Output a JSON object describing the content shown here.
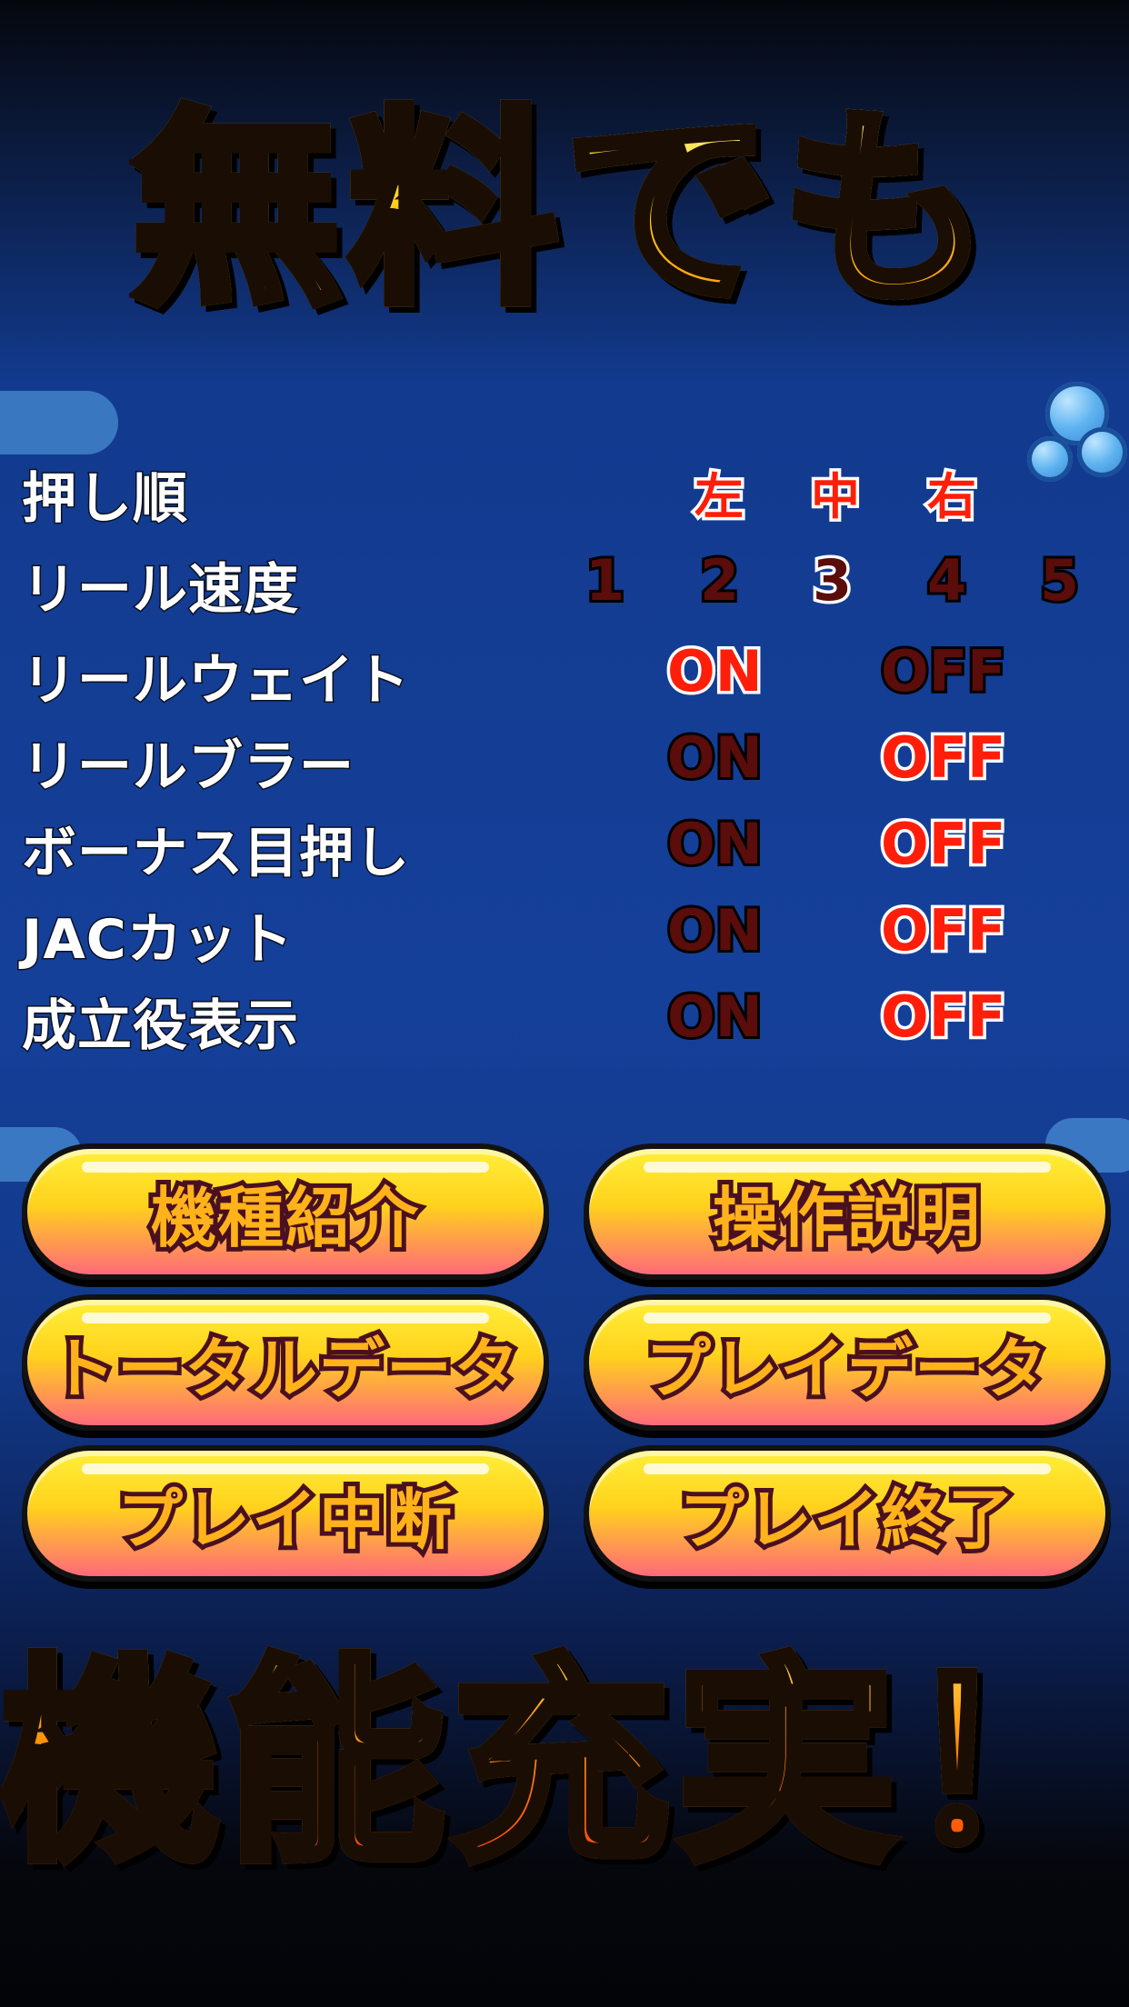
{
  "headline_top": "無料でも",
  "headline_bottom": "機能充実！",
  "settings": {
    "push_order": {
      "label": "押し順",
      "options": [
        "左",
        "中",
        "右"
      ],
      "selected": "左"
    },
    "reel_speed": {
      "label": "リール速度",
      "options": [
        "1",
        "2",
        "3",
        "4",
        "5"
      ],
      "selected": "3"
    },
    "reel_wait": {
      "label": "リールウェイト",
      "on": "ON",
      "off": "OFF",
      "selected": "ON"
    },
    "reel_blur": {
      "label": "リールブラー",
      "on": "ON",
      "off": "OFF",
      "selected": "OFF"
    },
    "bonus_aim": {
      "label": "ボーナス目押し",
      "on": "ON",
      "off": "OFF",
      "selected": "OFF"
    },
    "jac_cut": {
      "label": "JACカット",
      "on": "ON",
      "off": "OFF",
      "selected": "OFF"
    },
    "show_role": {
      "label": "成立役表示",
      "on": "ON",
      "off": "OFF",
      "selected": "OFF"
    }
  },
  "buttons": {
    "machine_intro": "機種紹介",
    "operation_guide": "操作説明",
    "total_data": "トータルデータ",
    "play_data": "プレイデータ",
    "play_pause": "プレイ中断",
    "play_end": "プレイ終了"
  },
  "colors": {
    "option_selected": "#ff1e0a",
    "option_unselected": "#5a0d0a",
    "button_top": "#ffef3a",
    "button_bottom": "#ff6a7a"
  }
}
